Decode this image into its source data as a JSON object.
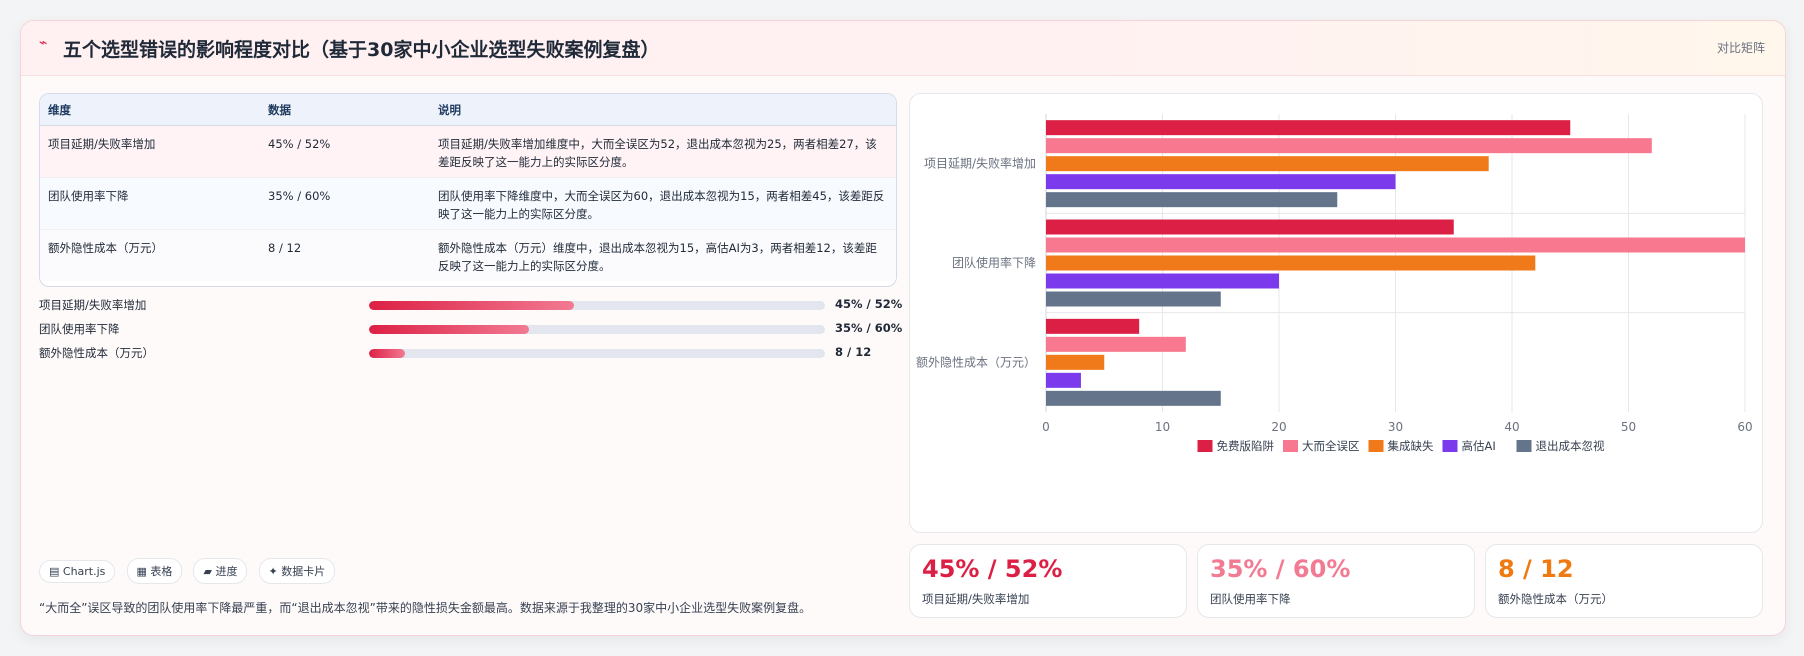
{
  "header": {
    "title": "五个选型错误的影响程度对比（基于30家中小企业选型失败案例复盘）",
    "tag": "对比矩阵"
  },
  "table": {
    "columns": [
      "维度",
      "数据",
      "说明"
    ],
    "rows": [
      {
        "dimension": "项目延期/失败率增加",
        "data": "45% / 52%",
        "note": "项目延期/失败率增加维度中，大而全误区为52，退出成本忽视为25，两者相差27，该差距反映了这一能力上的实际区分度。"
      },
      {
        "dimension": "团队使用率下降",
        "data": "35% / 60%",
        "note": "团队使用率下降维度中，大而全误区为60，退出成本忽视为15，两者相差45，该差距反映了这一能力上的实际区分度。"
      },
      {
        "dimension": "额外隐性成本（万元）",
        "data": "8 / 12",
        "note": "额外隐性成本（万元）维度中，退出成本忽视为15，高估AI为3，两者相差12，该差距反映了这一能力上的实际区分度。"
      }
    ]
  },
  "progress": [
    {
      "label": "项目延期/失败率增加",
      "value": "45% / 52%",
      "fill": 0.45
    },
    {
      "label": "团队使用率下降",
      "value": "35% / 60%",
      "fill": 0.35
    },
    {
      "label": "额外隐性成本（万元）",
      "value": "8 / 12",
      "fill": 0.08
    }
  ],
  "chips": [
    "Chart.js",
    "表格",
    "进度",
    "数据卡片"
  ],
  "footnote": "“大而全”误区导致的团队使用率下降最严重，而“退出成本忽视”带来的隐性损失金额最高。数据来源于我整理的30家中小企业选型失败案例复盘。",
  "stats": [
    {
      "value": "45% / 52%",
      "label": "项目延期/失败率增加",
      "color": "#dc2045"
    },
    {
      "value": "35% / 60%",
      "label": "团队使用率下降",
      "color": "#f27a92"
    },
    {
      "value": "8 / 12",
      "label": "额外隐性成本（万元）",
      "color": "#f07a10"
    }
  ],
  "chart_data": {
    "type": "bar",
    "orientation": "horizontal",
    "categories": [
      "项目延期/失败率增加",
      "团队使用率下降",
      "额外隐性成本（万元）"
    ],
    "series": [
      {
        "name": "免费版陷阱",
        "color": "#dc2045",
        "values": [
          45,
          35,
          8
        ]
      },
      {
        "name": "大而全误区",
        "color": "#f7788f",
        "values": [
          52,
          60,
          12
        ]
      },
      {
        "name": "集成缺失",
        "color": "#f07a1a",
        "values": [
          38,
          42,
          5
        ]
      },
      {
        "name": "高估AI",
        "color": "#7c3aed",
        "values": [
          30,
          20,
          3
        ]
      },
      {
        "name": "退出成本忽视",
        "color": "#64748b",
        "values": [
          25,
          15,
          15
        ]
      }
    ],
    "xlim": [
      0,
      60
    ],
    "xticks": [
      0,
      10,
      20,
      30,
      40,
      50,
      60
    ],
    "grid": true,
    "legend": "bottom"
  }
}
